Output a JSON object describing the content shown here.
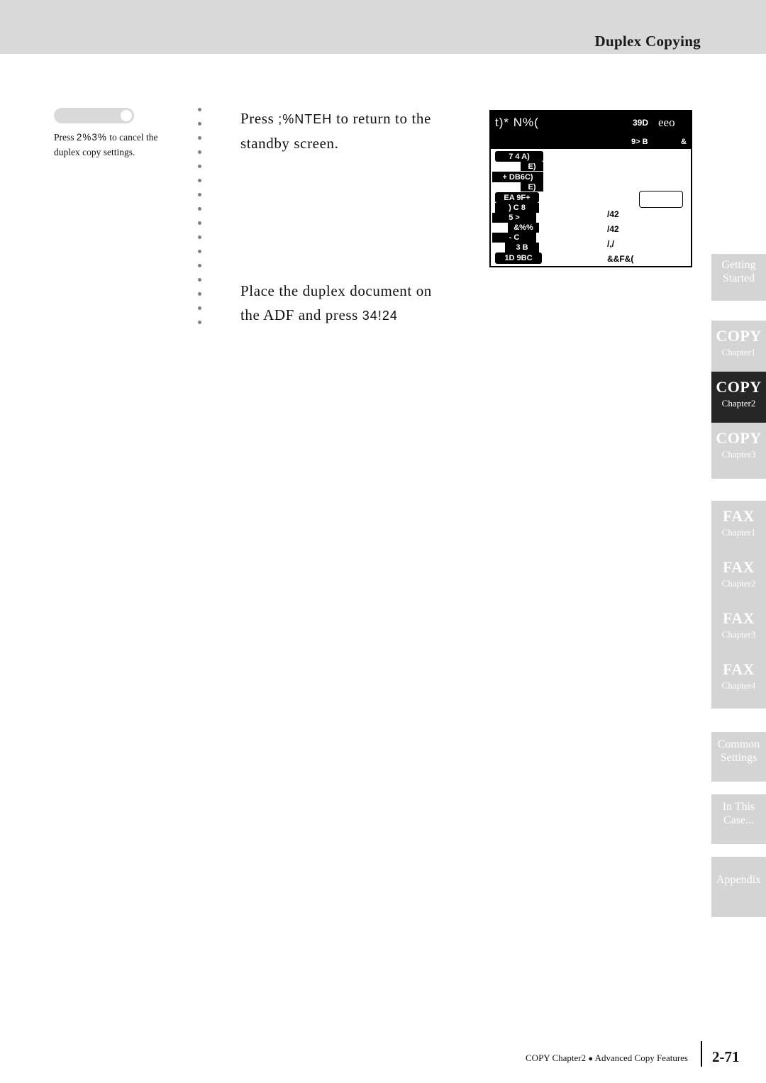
{
  "header": {
    "title": "Duplex Copying"
  },
  "note": {
    "line1_prefix": "Press",
    "line1_keys": "2%3%",
    "line1_suffix": "to cancel the",
    "line2": "duplex copy settings."
  },
  "steps": [
    {
      "prefix": "Press",
      "keys": ";%NTEH",
      "middle": "to return to the",
      "suffix": "standby screen."
    },
    {
      "line1": "Place the duplex document on",
      "line2_prefix": "the ADF and press",
      "line2_keys": "34!24"
    }
  ],
  "lcd": {
    "title_left": "t)*  N%(",
    "title_mid": "39D",
    "title_right": "eeo",
    "sub_left": "9>  B",
    "sub_right": "&",
    "buttons": [
      {
        "label": "7  4  A)"
      },
      {
        "label": "E)"
      },
      {
        "label": "+    DB6C)"
      },
      {
        "label": "E)"
      },
      {
        "label": "EA   9F+"
      },
      {
        "label": ")  C  8"
      },
      {
        "label": "5    >"
      },
      {
        "label": "&%%"
      },
      {
        "label": "-      C"
      },
      {
        "label": "3   B"
      },
      {
        "label": "1D   9BC"
      }
    ],
    "values": [
      "/42",
      "/42",
      "/,/",
      "&&F&("
    ]
  },
  "tabs": [
    {
      "big": "Getting",
      "small": "Started",
      "style": "twoline"
    },
    {
      "big": "COPY",
      "small": "Chapter1",
      "style": "normal"
    },
    {
      "big": "COPY",
      "small": "Chapter2",
      "style": "dark"
    },
    {
      "big": "COPY",
      "small": "Chapter3",
      "style": "normal"
    },
    {
      "big": "FAX",
      "small": "Chapter1",
      "style": "normal"
    },
    {
      "big": "FAX",
      "small": "Chapter2",
      "style": "normal"
    },
    {
      "big": "FAX",
      "small": "Chapter3",
      "style": "normal"
    },
    {
      "big": "FAX",
      "small": "Chapter4",
      "style": "normal"
    },
    {
      "big": "Common",
      "small": "Settings",
      "style": "twoline"
    },
    {
      "big": "In This",
      "small": "Case...",
      "style": "twoline"
    },
    {
      "big": "Appendix",
      "small": "",
      "style": "oneline"
    }
  ],
  "footer": {
    "text_left": "COPY Chapter2",
    "bullet": "●",
    "text_right": "Advanced Copy Features",
    "page": "2-71"
  }
}
